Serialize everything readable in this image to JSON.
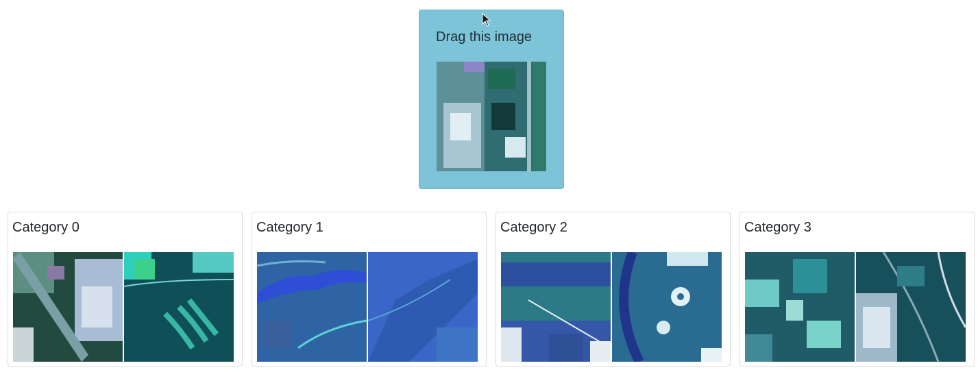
{
  "drag_source": {
    "label": "Drag this image",
    "image_icon": "satellite-image-icon"
  },
  "categories": [
    {
      "title": "Category 0"
    },
    {
      "title": "Category 1"
    },
    {
      "title": "Category 2"
    },
    {
      "title": "Category 3"
    }
  ],
  "colors": {
    "drag_card_bg": "#7ec4d9",
    "card_border": "#dcdcdc"
  }
}
